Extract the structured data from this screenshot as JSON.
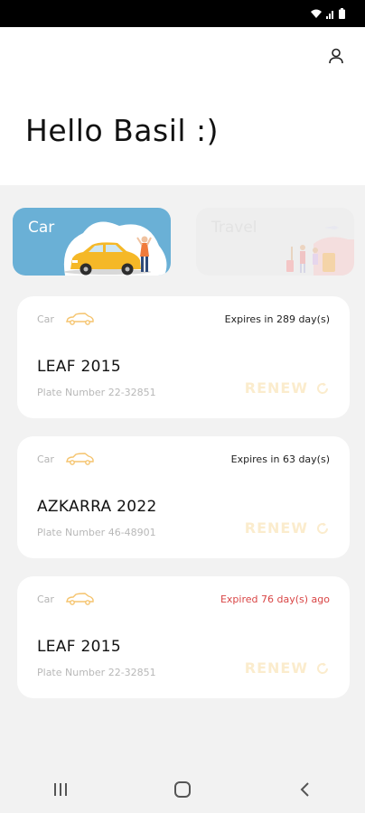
{
  "app": {
    "greeting": "Hello Basil :)"
  },
  "status_bar": {
    "icons": [
      "wifi-icon",
      "signal-icon",
      "battery-icon"
    ]
  },
  "header": {
    "profile_icon": "person-icon"
  },
  "categories": [
    {
      "label": "Car",
      "active": true
    },
    {
      "label": "Travel",
      "active": false
    }
  ],
  "insurances": [
    {
      "type": "Car",
      "expiry": "Expires in 289 day(s)",
      "expired": false,
      "name": "LEAF 2015",
      "plate": "Plate Number 22-32851",
      "action": "RENEW"
    },
    {
      "type": "Car",
      "expiry": "Expires in 63 day(s)",
      "expired": false,
      "name": "AZKARRA 2022",
      "plate": "Plate Number 46-48901",
      "action": "RENEW"
    },
    {
      "type": "Car",
      "expiry": "Expired 76 day(s) ago",
      "expired": true,
      "name": "LEAF 2015",
      "plate": "Plate Number 22-32851",
      "action": "RENEW"
    }
  ],
  "colors": {
    "car_card": "#6ab0d6",
    "accent": "#f5c46e",
    "expired": "#d94545"
  },
  "nav": {
    "items": [
      "recent-apps-icon",
      "home-icon",
      "back-icon"
    ]
  }
}
